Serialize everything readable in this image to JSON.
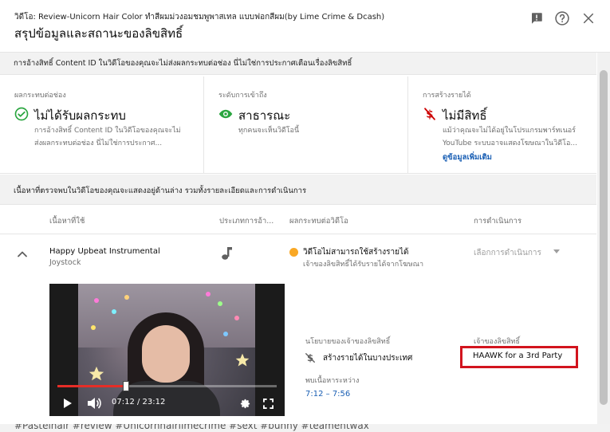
{
  "header": {
    "subtitle": "วิดีโอ: Review-Unicorn Hair Color ทำสีผมม่วงอมชมพูพาสเทล แบบฟอกสีผม(by Lime Crime & Dcash)",
    "title": "สรุปข้อมูลและสถานะของลิขสิทธิ์",
    "icons": [
      "feedback-icon",
      "help-icon",
      "close-icon"
    ]
  },
  "notice": "การอ้างสิทธิ์ Content ID ในวิดีโอของคุณจะไม่ส่งผลกระทบต่อช่อง นี่ไม่ใช่การประกาศเตือนเรื่องลิขสิทธิ์",
  "cards": [
    {
      "label": "ผลกระทบต่อช่อง",
      "value": "ไม่ได้รับผลกระทบ",
      "desc": "การอ้างสิทธิ์ Content ID ในวิดีโอของคุณจะไม่ส่งผลกระทบต่อช่อง นี่ไม่ใช่การประกาศ...",
      "icon": "check-circle-icon",
      "color": "#2ba640"
    },
    {
      "label": "ระดับการเข้าถึง",
      "value": "สาธารณะ",
      "desc": "ทุกคนจะเห็นวิดีโอนี้",
      "icon": "eye-icon",
      "color": "#2ba640"
    },
    {
      "label": "การสร้างรายได้",
      "value": "ไม่มีสิทธิ์",
      "desc": "แม้ว่าคุณจะไม่ได้อยู่ในโปรแกรมพาร์ทเนอร์ YouTube ระบบอาจแสดงโฆษณาในวิดีโอ...",
      "link": "ดูข้อมูลเพิ่มเติม",
      "icon": "no-money-icon",
      "color": "#cc0000"
    }
  ],
  "section": "เนื้อหาที่ตรวจพบในวิดีโอของคุณจะแสดงอยู่ด้านล่าง รวมทั้งรายละเอียดและการดำเนินการ",
  "table": {
    "headers": [
      "เนื้อหาที่ใช้",
      "ประเภทการอ้า...",
      "ผลกระทบต่อวิดีโอ",
      "การดำเนินการ"
    ],
    "row": {
      "title": "Happy Upbeat Instrumental",
      "artist": "Joystock",
      "type_icon": "music-note-icon",
      "impact": "วิดีโอไม่สามารถใช้สร้างรายได้",
      "impact_sub": "เจ้าของลิขสิทธิ์ได้รับรายได้จากโฆษณา",
      "impact_color": "#f9a825",
      "action": "เลือกการดำเนินการ",
      "policy_label": "นโยบายของเจ้าของลิขสิทธิ์",
      "policy_value": "สร้างรายได้ในบางประเทศ",
      "found_label": "พบเนื้อหาระหว่าง",
      "found_range": "7:12 – 7:56",
      "owner_label": "เจ้าของลิขสิทธิ์",
      "owner_value": "HAAWK for a 3rd Party"
    }
  },
  "video": {
    "time": "07:12 / 23:12",
    "progress": 0.311
  },
  "tags": "#Pastelhair #review #Unicornhairlimecrime #sext #bunny #teamentwax"
}
